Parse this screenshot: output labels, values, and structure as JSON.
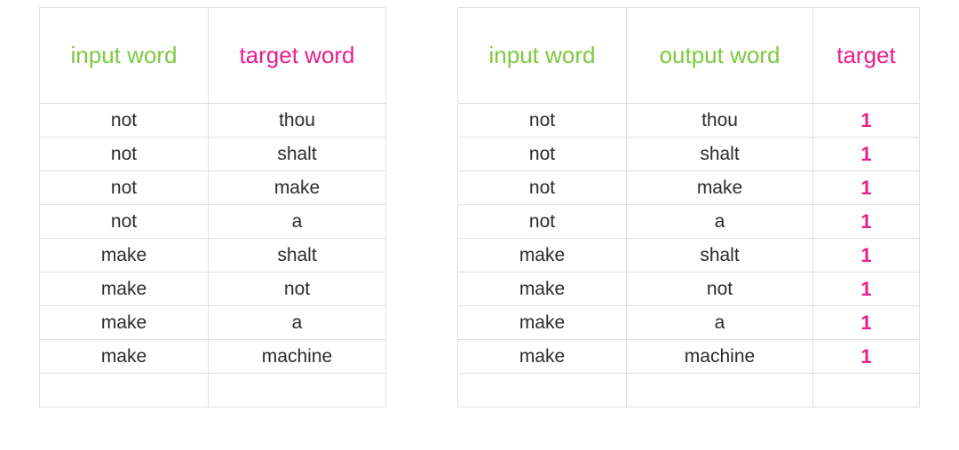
{
  "colors": {
    "green": "#7cc93e",
    "pink": "#e91e8c",
    "border": "#e0e0e0"
  },
  "tableLeft": {
    "headers": {
      "col1": "input word",
      "col2": "target word"
    },
    "rows": [
      {
        "c1": "not",
        "c2": "thou"
      },
      {
        "c1": "not",
        "c2": "shalt"
      },
      {
        "c1": "not",
        "c2": "make"
      },
      {
        "c1": "not",
        "c2": "a"
      },
      {
        "c1": "make",
        "c2": "shalt"
      },
      {
        "c1": "make",
        "c2": "not"
      },
      {
        "c1": "make",
        "c2": "a"
      },
      {
        "c1": "make",
        "c2": "machine"
      }
    ],
    "emptyTrailingRow": true
  },
  "tableRight": {
    "headers": {
      "col1": "input word",
      "col2": "output word",
      "col3": "target"
    },
    "rows": [
      {
        "c1": "not",
        "c2": "thou",
        "c3": "1"
      },
      {
        "c1": "not",
        "c2": "shalt",
        "c3": "1"
      },
      {
        "c1": "not",
        "c2": "make",
        "c3": "1"
      },
      {
        "c1": "not",
        "c2": "a",
        "c3": "1"
      },
      {
        "c1": "make",
        "c2": "shalt",
        "c3": "1"
      },
      {
        "c1": "make",
        "c2": "not",
        "c3": "1"
      },
      {
        "c1": "make",
        "c2": "a",
        "c3": "1"
      },
      {
        "c1": "make",
        "c2": "machine",
        "c3": "1"
      }
    ],
    "emptyTrailingRow": true
  }
}
